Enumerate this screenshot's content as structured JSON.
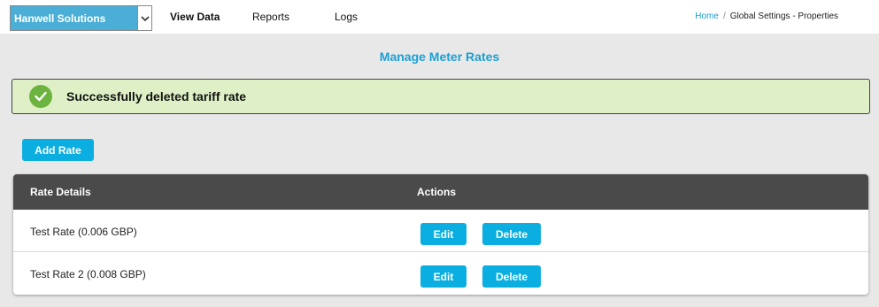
{
  "header": {
    "company": "Hanwell Solutions",
    "nav": [
      "View Data",
      "Reports",
      "Logs"
    ],
    "breadcrumb": {
      "home": "Home",
      "separator": "/",
      "current": "Global Settings - Properties"
    }
  },
  "page": {
    "title": "Manage Meter Rates"
  },
  "alert": {
    "message": "Successfully deleted tariff rate",
    "type": "success",
    "color": "#dff0c6"
  },
  "actions": {
    "add_label": "Add Rate"
  },
  "table": {
    "columns": [
      "Rate Details",
      "Actions"
    ],
    "rows": [
      {
        "name": "Test Rate (0.006 GBP)",
        "edit": "Edit",
        "delete": "Delete"
      },
      {
        "name": "Test Rate 2 (0.008 GBP)",
        "edit": "Edit",
        "delete": "Delete"
      }
    ]
  },
  "colors": {
    "accent": "#0aaee0",
    "select_bg": "#4aaed6",
    "table_header": "#4a4a4a",
    "success_icon": "#6db33f"
  },
  "icons": {
    "dropdown": "chevron-down-icon",
    "success": "check-circle-icon"
  }
}
